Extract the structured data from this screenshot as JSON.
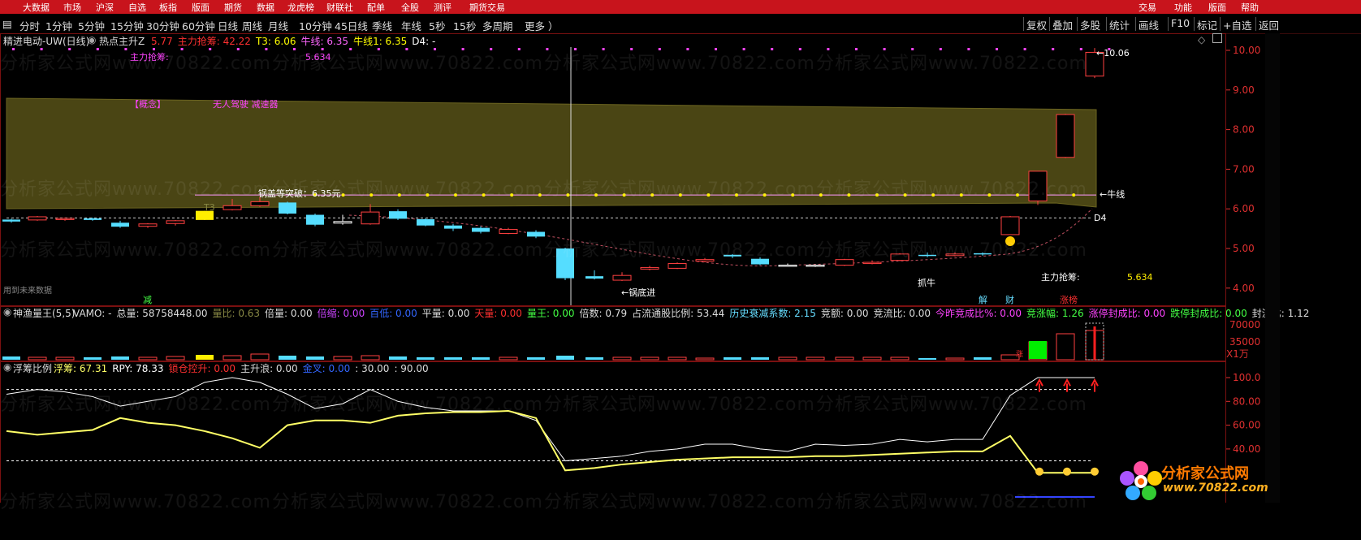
{
  "top_menu": [
    "大数据",
    "市场",
    "沪深",
    "自选",
    "板指",
    "版面",
    "期货",
    "数据",
    "龙虎榜",
    "财联社",
    "配单",
    "全股",
    "测评",
    "期货交易",
    "交易",
    "功能",
    "版面",
    "帮助"
  ],
  "period_bar": {
    "left_items": [
      "分时",
      "1分钟",
      "5分钟",
      "15分钟",
      "30分钟",
      "60分钟",
      "日线",
      "周线",
      "月线",
      "10分钟",
      "45日线",
      "季线",
      "年线",
      "5秒",
      "15秒",
      "多周期",
      "更多 ）"
    ],
    "right_items": [
      "复权",
      "叠加",
      "多股",
      "统计",
      "画线",
      "F10",
      "标记",
      "+自选",
      "返回"
    ]
  },
  "main_chart": {
    "title": "精进电动-UW(日线)",
    "indicator_name": "热点主升Z",
    "legend": [
      {
        "label": "",
        "value": "5.77",
        "color": "#ff3030"
      },
      {
        "label": "主力抢筹:",
        "value": "42.22",
        "color": "#ff3030"
      },
      {
        "label": "T3:",
        "value": "6.06",
        "color": "#ffff00"
      },
      {
        "label": "牛线:",
        "value": "6.35",
        "color": "#ff66ff"
      },
      {
        "label": "牛线1:",
        "value": "6.35",
        "color": "#ffff00"
      },
      {
        "label": "D4:",
        "value": "-",
        "color": "#ffffff"
      }
    ],
    "annotations": {
      "zhuli_label": "主力抢筹:",
      "zhuli_value": "5.634",
      "concept": "【概念】",
      "concept2": "无人驾驶  减速器",
      "breakout": "锅盖等突破：6.35元",
      "t3": "T3",
      "bull_line": "←牛线",
      "d4": "D4",
      "high_price": "←10.06",
      "guodi": "←锅底进",
      "zhuaniu": "抓牛",
      "zhuli_bottom_label": "主力抢筹:",
      "zhuli_bottom_value": "5.634",
      "future": "用到未来数据",
      "jian": "减",
      "jie": "解",
      "cai": "财",
      "zhangbang": "涨榜"
    },
    "y_ticks": [
      "10.00",
      "9.00",
      "8.00",
      "7.00",
      "6.00",
      "5.00",
      "4.00"
    ]
  },
  "volume_panel": {
    "title": "神渔量王(5,5)",
    "legend": [
      {
        "label": "VAMO:",
        "value": "-",
        "color": "#dddddd"
      },
      {
        "label": "总量:",
        "value": "58758448.00",
        "color": "#dddddd"
      },
      {
        "label": "量比:",
        "value": "0.63",
        "color": "#888844"
      },
      {
        "label": "倍量:",
        "value": "0.00",
        "color": "#dddddd"
      },
      {
        "label": "倍缩:",
        "value": "0.00",
        "color": "#cc44ff"
      },
      {
        "label": "百低:",
        "value": "0.00",
        "color": "#3366ff"
      },
      {
        "label": "平量:",
        "value": "0.00",
        "color": "#dddddd"
      },
      {
        "label": "天量:",
        "value": "0.00",
        "color": "#ff3030"
      },
      {
        "label": "量王:",
        "value": "0.00",
        "color": "#44ff44"
      },
      {
        "label": "倍数:",
        "value": "0.79",
        "color": "#dddddd"
      },
      {
        "label": "占流通股比例:",
        "value": "53.44",
        "color": "#dddddd"
      },
      {
        "label": "历史衰减系数:",
        "value": "2.15",
        "color": "#66ddff"
      },
      {
        "label": "竞额:",
        "value": "0.00",
        "color": "#dddddd"
      },
      {
        "label": "竞流比:",
        "value": "0.00",
        "color": "#dddddd"
      },
      {
        "label": "今昨竞成比%:",
        "value": "0.00",
        "color": "#ff44ff"
      },
      {
        "label": "竞涨幅:",
        "value": "1.26",
        "color": "#44ff44"
      },
      {
        "label": "涨停封成比:",
        "value": "0.00",
        "color": "#ff44ff"
      },
      {
        "label": "跌停封成比:",
        "value": "0.00",
        "color": "#44ff44"
      },
      {
        "label": "封流比:",
        "value": "1.12",
        "color": "#dddddd"
      }
    ],
    "y_ticks": [
      "70000",
      "35000"
    ],
    "unit": "X1万"
  },
  "fuchou_panel": {
    "title": "浮筹比例",
    "legend": [
      {
        "label": "浮筹:",
        "value": "67.31",
        "color": "#ffff66"
      },
      {
        "label": "RPY:",
        "value": "78.33",
        "color": "#ffffff"
      },
      {
        "label": "锁仓控升:",
        "value": "0.00",
        "color": "#ff3030"
      },
      {
        "label": "主升浪:",
        "value": "0.00",
        "color": "#dddddd"
      },
      {
        "label": "金叉:",
        "value": "0.00",
        "color": "#3366ff"
      },
      {
        "label": ":",
        "value": "30.00",
        "color": "#dddddd"
      },
      {
        "label": ":",
        "value": "90.00",
        "color": "#dddddd"
      }
    ],
    "y_ticks": [
      "100.0",
      "80.00",
      "60.00",
      "40.00"
    ]
  },
  "watermark": {
    "text": "分析家公式网www.70822.com",
    "logo_text": "分析家公式网",
    "logo_url": "www.70822.com"
  },
  "colors": {
    "up": "#ff4040",
    "down": "#55ddff",
    "menu_bg": "#c8141c",
    "axis": "#e03030"
  }
}
